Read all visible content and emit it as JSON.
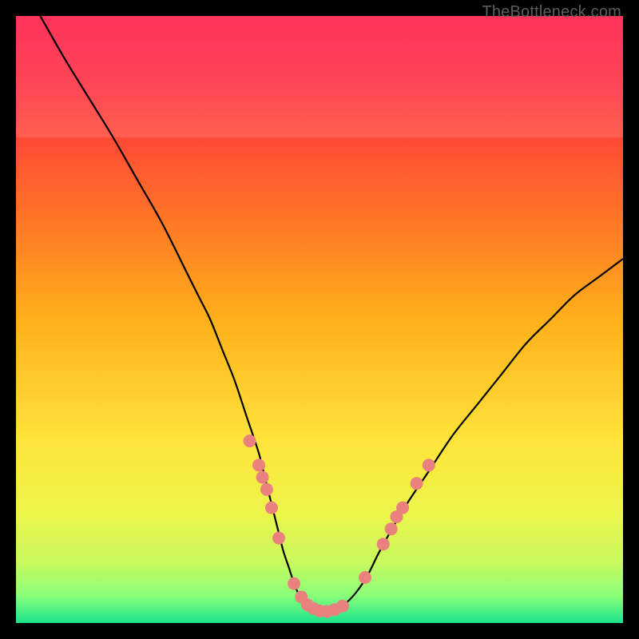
{
  "watermark": "TheBottleneck.com",
  "chart_data": {
    "type": "line",
    "title": "",
    "xlabel": "",
    "ylabel": "",
    "xlim": [
      0,
      100
    ],
    "ylim": [
      0,
      100
    ],
    "x": [
      4,
      8,
      12,
      16,
      20,
      24,
      28,
      30,
      32,
      34,
      36,
      38,
      40,
      41,
      42,
      43,
      44,
      45,
      46,
      47,
      48,
      49,
      50,
      52,
      54,
      56,
      58,
      60,
      64,
      68,
      72,
      76,
      80,
      84,
      88,
      92,
      96,
      100
    ],
    "values": [
      100,
      93,
      86.5,
      80,
      73,
      66,
      58,
      54,
      50,
      45,
      40,
      34,
      28,
      24,
      20,
      16,
      12,
      9,
      6,
      4,
      3,
      2,
      2,
      2,
      3,
      5,
      8,
      12,
      19,
      25,
      31,
      36,
      41,
      46,
      50,
      54,
      57,
      60
    ],
    "background_gradient_stops": [
      {
        "pos": 0.0,
        "color": "#ff1744"
      },
      {
        "pos": 0.12,
        "color": "#ff2f3f"
      },
      {
        "pos": 0.3,
        "color": "#ff6a2a"
      },
      {
        "pos": 0.5,
        "color": "#ffb01a"
      },
      {
        "pos": 0.7,
        "color": "#ffe43a"
      },
      {
        "pos": 0.82,
        "color": "#ecf54a"
      },
      {
        "pos": 0.9,
        "color": "#c8f85e"
      },
      {
        "pos": 0.955,
        "color": "#8aff7a"
      },
      {
        "pos": 1.0,
        "color": "#19e38a"
      }
    ],
    "highlight_band": {
      "y_start": 80,
      "y_end": 100,
      "alpha": 0.12,
      "color": "#ffffff"
    },
    "markers": [
      {
        "x": 38.5,
        "y": 30
      },
      {
        "x": 40.0,
        "y": 26
      },
      {
        "x": 40.6,
        "y": 24
      },
      {
        "x": 41.3,
        "y": 22
      },
      {
        "x": 42.1,
        "y": 19
      },
      {
        "x": 43.3,
        "y": 14
      },
      {
        "x": 45.8,
        "y": 6.5
      },
      {
        "x": 47.0,
        "y": 4.3
      },
      {
        "x": 48.0,
        "y": 3.0
      },
      {
        "x": 49.0,
        "y": 2.4
      },
      {
        "x": 50.0,
        "y": 2.0
      },
      {
        "x": 51.2,
        "y": 1.9
      },
      {
        "x": 52.5,
        "y": 2.2
      },
      {
        "x": 53.8,
        "y": 2.8
      },
      {
        "x": 57.5,
        "y": 7.5
      },
      {
        "x": 60.5,
        "y": 13
      },
      {
        "x": 61.8,
        "y": 15.5
      },
      {
        "x": 62.7,
        "y": 17.5
      },
      {
        "x": 63.7,
        "y": 19
      },
      {
        "x": 66.0,
        "y": 23
      },
      {
        "x": 68.0,
        "y": 26
      }
    ],
    "marker_color": "#e9817f",
    "marker_radius": 8
  }
}
